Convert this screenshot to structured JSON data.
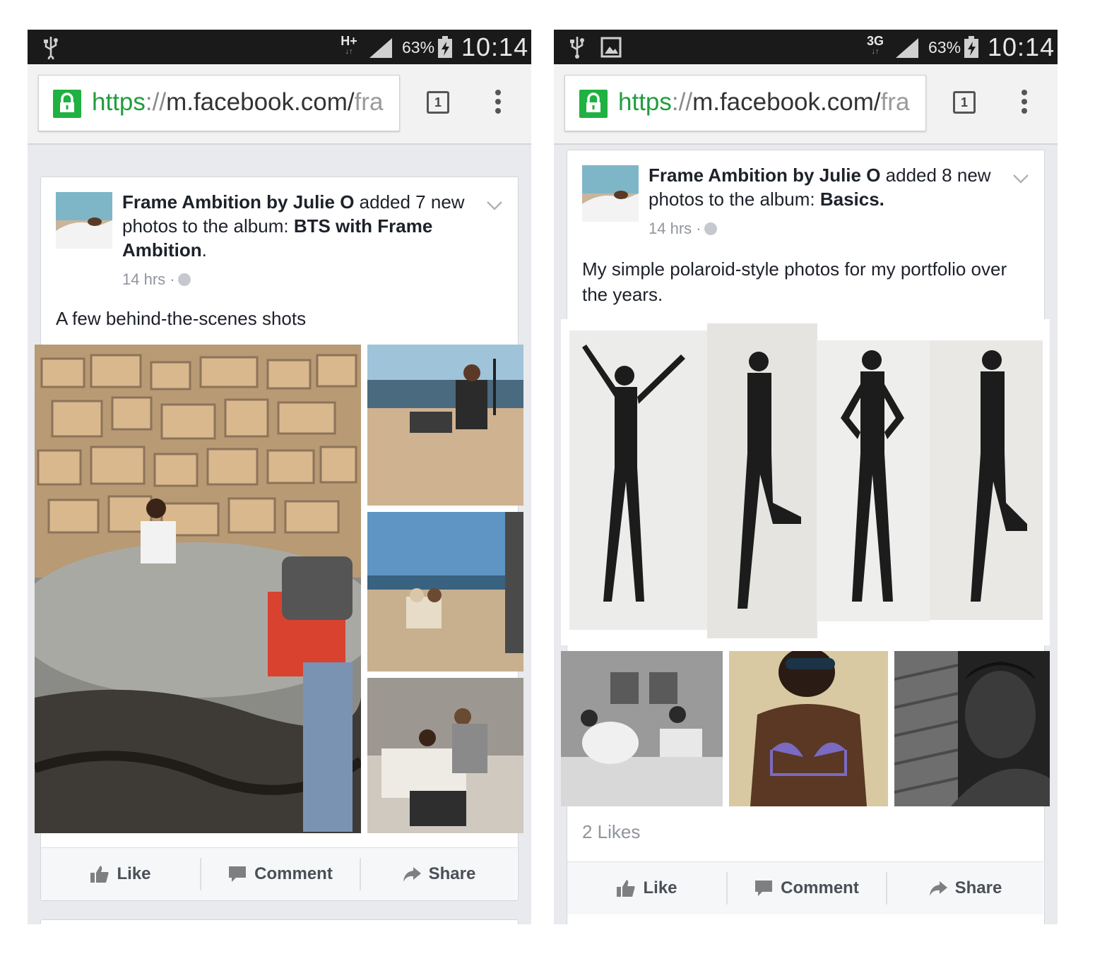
{
  "status_bar": {
    "time": "10:14",
    "battery": "63%",
    "left_network": "H+",
    "right_network": "3G",
    "network_sub": "↓↑"
  },
  "browser": {
    "url_scheme": "https",
    "url_sep": "://",
    "url_host": "m.facebook.com/",
    "url_rest": "fra",
    "tab_count": "1"
  },
  "left_post": {
    "page_name": "Frame Ambition by Julie O",
    "action_text": " added 7 new photos to the album: ",
    "album": "BTS with Frame Ambition",
    "album_suffix": ".",
    "time": "14 hrs ·",
    "caption": "A few behind-the-scenes shots",
    "like_label": "Like",
    "comment_label": "Comment",
    "share_label": "Share"
  },
  "right_post": {
    "page_name": "Frame Ambition by Julie O",
    "action_text": " added 8 new photos to the album: ",
    "album": "Basics.",
    "time": "14 hrs ·",
    "caption": "My simple polaroid-style photos for my portfolio over the years.",
    "likes_count": "2 Likes",
    "like_label": "Like",
    "comment_label": "Comment",
    "share_label": "Share"
  },
  "icons": {
    "usb": "usb-icon",
    "image": "image-notification-icon",
    "signal": "signal-icon",
    "battery": "battery-charging-icon",
    "lock": "lock-icon",
    "tabs": "tabs-icon",
    "menu": "overflow-menu-icon",
    "chevron": "chevron-down-icon",
    "globe": "globe-icon",
    "like": "thumbs-up-icon",
    "comment": "comment-icon",
    "share": "share-arrow-icon"
  },
  "colors": {
    "secure_green": "#1fb141",
    "status_bar": "#1a1a1a",
    "feed_bg": "#e9eaed",
    "text": "#1d2129",
    "meta_gray": "#90949c"
  }
}
